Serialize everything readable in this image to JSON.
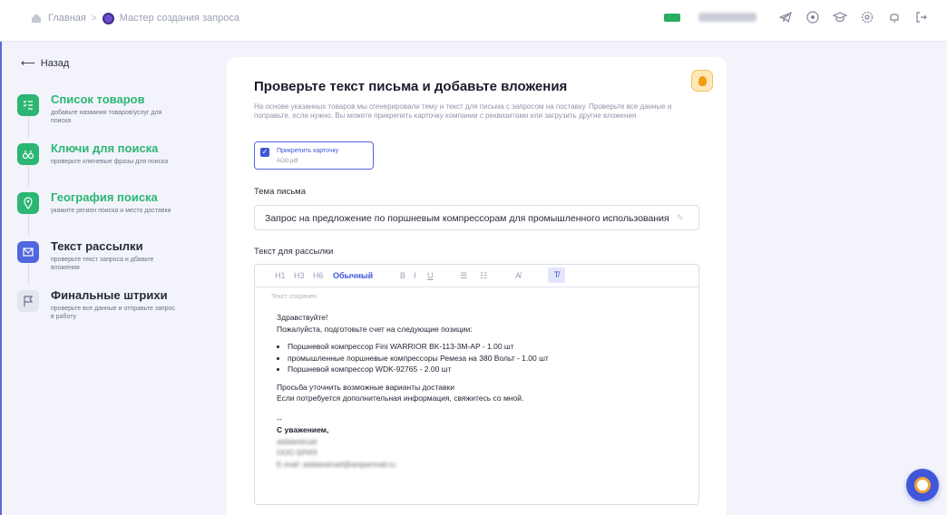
{
  "breadcrumb": {
    "home": "Главная",
    "current": "Мастер создания запроса"
  },
  "header": {
    "user": "aidatestruet"
  },
  "sidebar": {
    "back_label": "Назад",
    "steps": [
      {
        "title": "Список товаров",
        "desc": "добавьте названия товаров/услуг для поиска",
        "state": "done"
      },
      {
        "title": "Ключи для поиска",
        "desc": "проверьте ключевые фразы для поиска",
        "state": "done"
      },
      {
        "title": "География поиска",
        "desc": "укажите регион поиска и место доставки",
        "state": "done"
      },
      {
        "title": "Текст рассылки",
        "desc": "проверьте текст запроса и дбавьте вложения",
        "state": "active"
      },
      {
        "title": "Финальные штрихи",
        "desc": "проверьте все данные и отправьте запрос в работу",
        "state": "pending"
      }
    ]
  },
  "main": {
    "title": "Проверьте текст письма и добавьте вложения",
    "subtitle": "На основе указанных товаров мы сгенерировали тему и текст для письма с запросом на поставку. Проверьте все данные и поправьте, если нужно. Вы можете прикрепить карточку компании с реквизитами или загрузить другие вложения",
    "attachment": {
      "label": "Прикрепить карточку",
      "file": "AOO.pdf",
      "checked": true
    },
    "subject_label": "Тема письма",
    "subject_value": "Запрос на предложение по поршневым компрессорам для промышленного использования",
    "text_label": "Текст для рассылки",
    "toolbar": {
      "h1": "H1",
      "h3": "H3",
      "h6": "H6",
      "normal": "Обычный",
      "bold": "B",
      "italic": "I",
      "underline": "U"
    },
    "saved_status": "Текст сохранен",
    "body": {
      "greeting": "Здравствуйте!",
      "intro": "Пожалуйста, подготовьте счет на следующие позиции:",
      "items": [
        "Поршневой компрессор Fini WARRIOR BK-113-3M-AP - 1.00 шт",
        "промышленные поршневые компрессоры Ремеза на 380 Вольт - 1.00 шт",
        "Поршневой компрессор WDK-92765 - 2.00 шт"
      ],
      "line1": "Просьба уточнить возможные варианты доставки",
      "line2": "Если потребуется дополнительная информация, свяжитесь со мной.",
      "sep": "--",
      "regards": "С уважением,",
      "sig_name": "aidatestruet",
      "sig_company": "ООО БРИЗ",
      "sig_email": "E-mail: aidatestruet@aniparmail.ru"
    }
  },
  "colors": {
    "accent": "#3f57d8",
    "green": "#2bb673",
    "bg": "#f3f3fb"
  }
}
